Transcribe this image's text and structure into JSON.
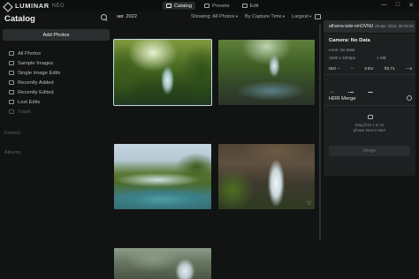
{
  "app": {
    "logo_text": "LUMINAR",
    "logo_sub": "NEO"
  },
  "tabs": [
    {
      "label": "Catalog",
      "icon": "catalog-icon",
      "active": true
    },
    {
      "label": "Presets",
      "icon": "presets-icon",
      "active": false
    },
    {
      "label": "Edit",
      "icon": "edit-icon",
      "active": false
    }
  ],
  "window_controls": [
    "—",
    "□",
    "✕"
  ],
  "sidebar": {
    "title": "Catalog",
    "add_button": "Add Photos",
    "items": [
      {
        "label": "All Photos",
        "muted": false
      },
      {
        "label": "Sample Images",
        "muted": false
      },
      {
        "label": "Single Image Edits",
        "muted": false
      },
      {
        "label": "Recently Added",
        "muted": false
      },
      {
        "label": "Recently Edited",
        "muted": false
      },
      {
        "label": "Lost Edits",
        "muted": false
      },
      {
        "label": "Trash",
        "muted": true
      }
    ],
    "folders_label": "Folders",
    "albums_label": "Albums"
  },
  "toolbar": {
    "date": "авг. 2022",
    "showing": "Showing: All Photos",
    "sort": "By Capture Time",
    "size": "Largest"
  },
  "info_panel": {
    "filename": "atharva-tulsi-nmOVNU",
    "date": "29 авг. 2022, 09:29:28",
    "camera": "Camera: No Data",
    "lens": "Lens: No Data",
    "dimensions": "1500 x 1004px",
    "file_size": "1 MB",
    "exif": [
      "ISO --",
      "--",
      "0 EV",
      "f/0,71",
      "---s"
    ]
  },
  "hdr_merge": {
    "title": "HDR Merge",
    "drop_line1": "Drag from 1 to 10",
    "drop_line2": "photos here to start",
    "button": "Merge"
  },
  "colors": {
    "background": "#121313",
    "panel": "#1d1f20",
    "accent_border": "#c6d8e0"
  }
}
